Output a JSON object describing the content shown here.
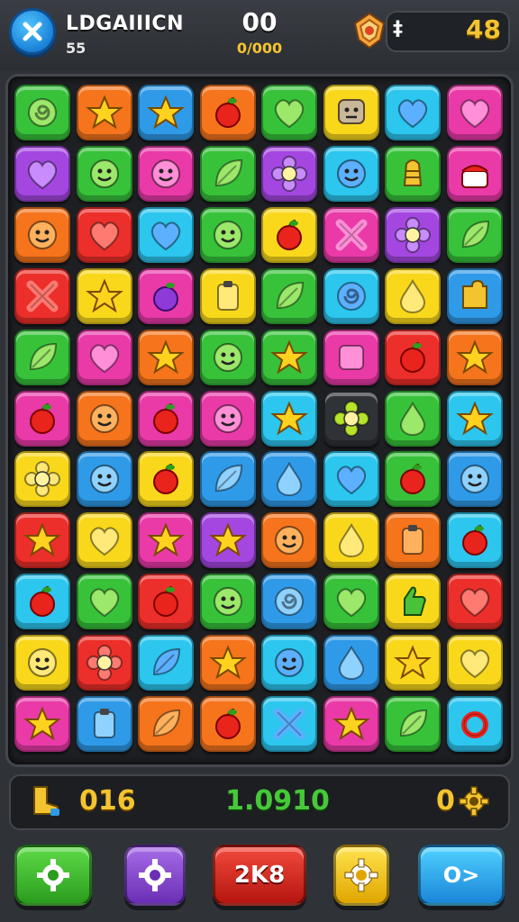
{
  "header": {
    "close_icon": "close-icon",
    "title": "LDGAIIICN",
    "subtitle": "55",
    "score": "00",
    "moves": "0/000",
    "coin_icon": "shield-coin-icon",
    "coin_symbol": "‡",
    "coins": "48"
  },
  "board": {
    "rows": 11,
    "cols": 8,
    "tiles": [
      [
        "green:swirl",
        "orange:star",
        "blue:star",
        "orange:apple",
        "green:heart",
        "yellow:face-box",
        "cyan:heart",
        "pink:heart"
      ],
      [
        "purple:heart",
        "green:face",
        "pink:face",
        "green:leaf",
        "purple:flower",
        "cyan:face",
        "green:bell",
        "pink:cake"
      ],
      [
        "orange:face",
        "red:heart",
        "cyan:heart",
        "green:face",
        "yellow:apple",
        "pink:x",
        "purple:flower",
        "green:leaf"
      ],
      [
        "red:x",
        "yellow:star",
        "pink:plum",
        "yellow:box",
        "green:leaf",
        "cyan:swirl",
        "yellow:drop",
        "blue:puzzle"
      ],
      [
        "green:leaf",
        "pink:heart",
        "orange:star",
        "green:face",
        "green:star",
        "pink:square",
        "red:apple",
        "orange:star"
      ],
      [
        "pink:apple",
        "orange:face",
        "pink:apple",
        "pink:face",
        "cyan:star",
        "dark:flower",
        "green:drop",
        "cyan:star"
      ],
      [
        "yellow:flower",
        "blue:face",
        "yellow:apple",
        "blue:leaf",
        "blue:drop",
        "cyan:heart",
        "green:apple",
        "blue:face"
      ],
      [
        "red:star",
        "yellow:heart",
        "pink:star",
        "purple:star",
        "orange:face",
        "yellow:drop",
        "orange:box",
        "cyan:apple"
      ],
      [
        "cyan:apple",
        "green:heart",
        "red:apple",
        "green:face",
        "blue:swirl",
        "green:heart",
        "yellow:hand",
        "red:heart"
      ],
      [
        "yellow:face",
        "red:flower",
        "cyan:leaf",
        "orange:star",
        "cyan:face",
        "blue:drop",
        "yellow:star",
        "yellow:heart"
      ],
      [
        "pink:star",
        "blue:box",
        "orange:leaf",
        "orange:apple",
        "cyan:x",
        "pink:star",
        "green:leaf",
        "cyan:ring"
      ]
    ]
  },
  "stats": {
    "left_icon": "boot-icon",
    "left_value": "016",
    "middle_value": "1.0910",
    "right_value": "0",
    "right_icon": "gear-icon"
  },
  "buttons": {
    "green_icon": "gear-icon",
    "purple_icon": "gear-icon",
    "red_label": "2K8",
    "yellow_icon": "gear-icon",
    "blue_label": "O>"
  },
  "colors": {
    "green": "#37c23a",
    "orange": "#f5741c",
    "blue": "#2f9ae8",
    "cyan": "#2cc6ef",
    "yellow": "#f9d81c",
    "pink": "#e93aa8",
    "purple": "#a447e0",
    "red": "#ec2f2a",
    "dark": "#2f3236"
  }
}
